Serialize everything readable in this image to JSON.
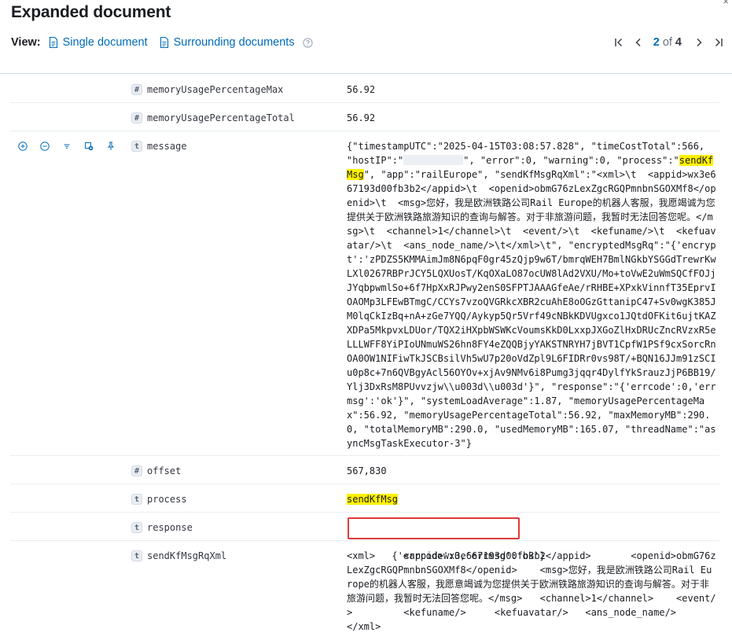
{
  "flyout": {
    "title": "Expanded document",
    "close": "×",
    "view_label": "View:",
    "links": [
      {
        "label": "Single document"
      },
      {
        "label": "Surrounding documents"
      }
    ],
    "pager": {
      "current": "2",
      "of": "of",
      "total": "4"
    }
  },
  "fields": [
    {
      "name": "memoryUsagePercentageMax",
      "type": "#",
      "value": "56.92"
    },
    {
      "name": "memoryUsagePercentageTotal",
      "type": "#",
      "value": "56.92"
    },
    {
      "name": "message",
      "type": "t",
      "value_before": "{\"timestampUTC\":\"2025-04-15T03:08:57.828\", \"timeCostTotal\":566, \"hostIP\":\"",
      "value_after_ip": "\", \"error\":0, \"warning\":0, \"process\":\"",
      "highlight": "sendKfMsg",
      "value_rest": "\", \"app\":\"railEurope\", \"sendKfMsgRqXml\":\"<xml>\\t  <appid>wx3e667193d00fb3b2</appid>\\t  <openid>obmG76zLexZgcRGQPmnbnSGOXMf8</openid>\\t  <msg>您好，我是欧洲铁路公司Rail Europe的机器人客服，我愿竭诚为您提供关于欧洲铁路旅游知识的查询与解答。对于非旅游问题，我暂时无法回答您呢。</msg>\\t  <channel>1</channel>\\t  <event/>\\t  <kefuname/>\\t  <kefuavatar/>\\t  <ans_node_name/>\\t</xml>\\t\", \"encryptedMsgRq\":\"{'encrypt':'zPDZS5KMMAimJm8N6pqF0gr45zQjp9w6T/bmrqWEH7BmlNGkbYSGGdTrewrKwLXl0267RBPrJCY5LQXUosT/KqOXaLO87ocUW8lAd2VXU/Mo+toVwE2uWmSQCfFOJjJYqbpwmlSo+6f7HpXxRJPwy2enS0SFPTJAAAGfeAe/rRHBE+XPxkVinnfT35EprvIOAOMp3LFEwBTmgC/CCYs7vzoQVGRkcXBR2cuAhE8oOGzGttanipC47+Sv0wgK385JM0lqCkIzBq+nA+zGe7YQQ/Aykyp5Qr5Vrf49cNBkKDVUgxco1JQtdOFKit6ujtKAZXDPa5MkpvxLDUor/TQX2iHXpbWSWKcVoumsKkD0LxxpJXGoZlHxDRUcZncRVzxR5eLLLWFF8YiPIoUNmuWS26hn8FY4eZQQBjyYAKSTNRYH7jBVT1CpfW1PSf9cxSorcRnOA0OW1NIFiwTkJSCBsilVh5wU7p20oVdZpl9L6FIDRr0vs98T/+BQN16JJm91zSCIu0p8c+7n6QVBgyAcl56OYOv+xjAv9NMv6i8Pumg3jqqr4DylfYkSrauzJjP6BB19/Ylj3DxRsM8PUvvzjw\\\\u003d\\\\u003d'}\", \"response\":\"{'errcode':0,'errmsg':'ok'}\", \"systemLoadAverage\":1.87, \"memoryUsagePercentageMax\":56.92, \"memoryUsagePercentageTotal\":56.92, \"maxMemoryMB\":290.0, \"totalMemoryMB\":290.0, \"usedMemoryMB\":165.07, \"threadName\":\"asyncMsgTaskExecutor-3\"}"
    },
    {
      "name": "offset",
      "type": "#",
      "value": "567,830"
    },
    {
      "name": "process",
      "type": "t",
      "value": "sendKfMsg"
    },
    {
      "name": "response",
      "type": "t",
      "value": "{'errcode':0,'errmsg':'ok'}"
    },
    {
      "name": "sendKfMsgRqXml",
      "type": "t",
      "value": "<xml>\t  <appid>wx3e667193d00fb3b2</appid>\t  <openid>obmG76zLexZgcRGQPmnbnSGOXMf8</openid>\t  <msg>您好，我是欧洲铁路公司Rail Europe的机器人客服，我愿意竭诚为您提供关于欧洲铁路旅游知识的查询与解答。对于非旅游问题，我暂时无法回答您呢。</msg>\t  <channel>1</channel>\t  <event/>\t  <kefuname/>\t  <kefuavatar/>\t  <ans_node_name/>\t</xml>"
    }
  ],
  "colors": {
    "link": "#006bb8",
    "highlight": "#fff000",
    "callout": "#e03a3a"
  }
}
